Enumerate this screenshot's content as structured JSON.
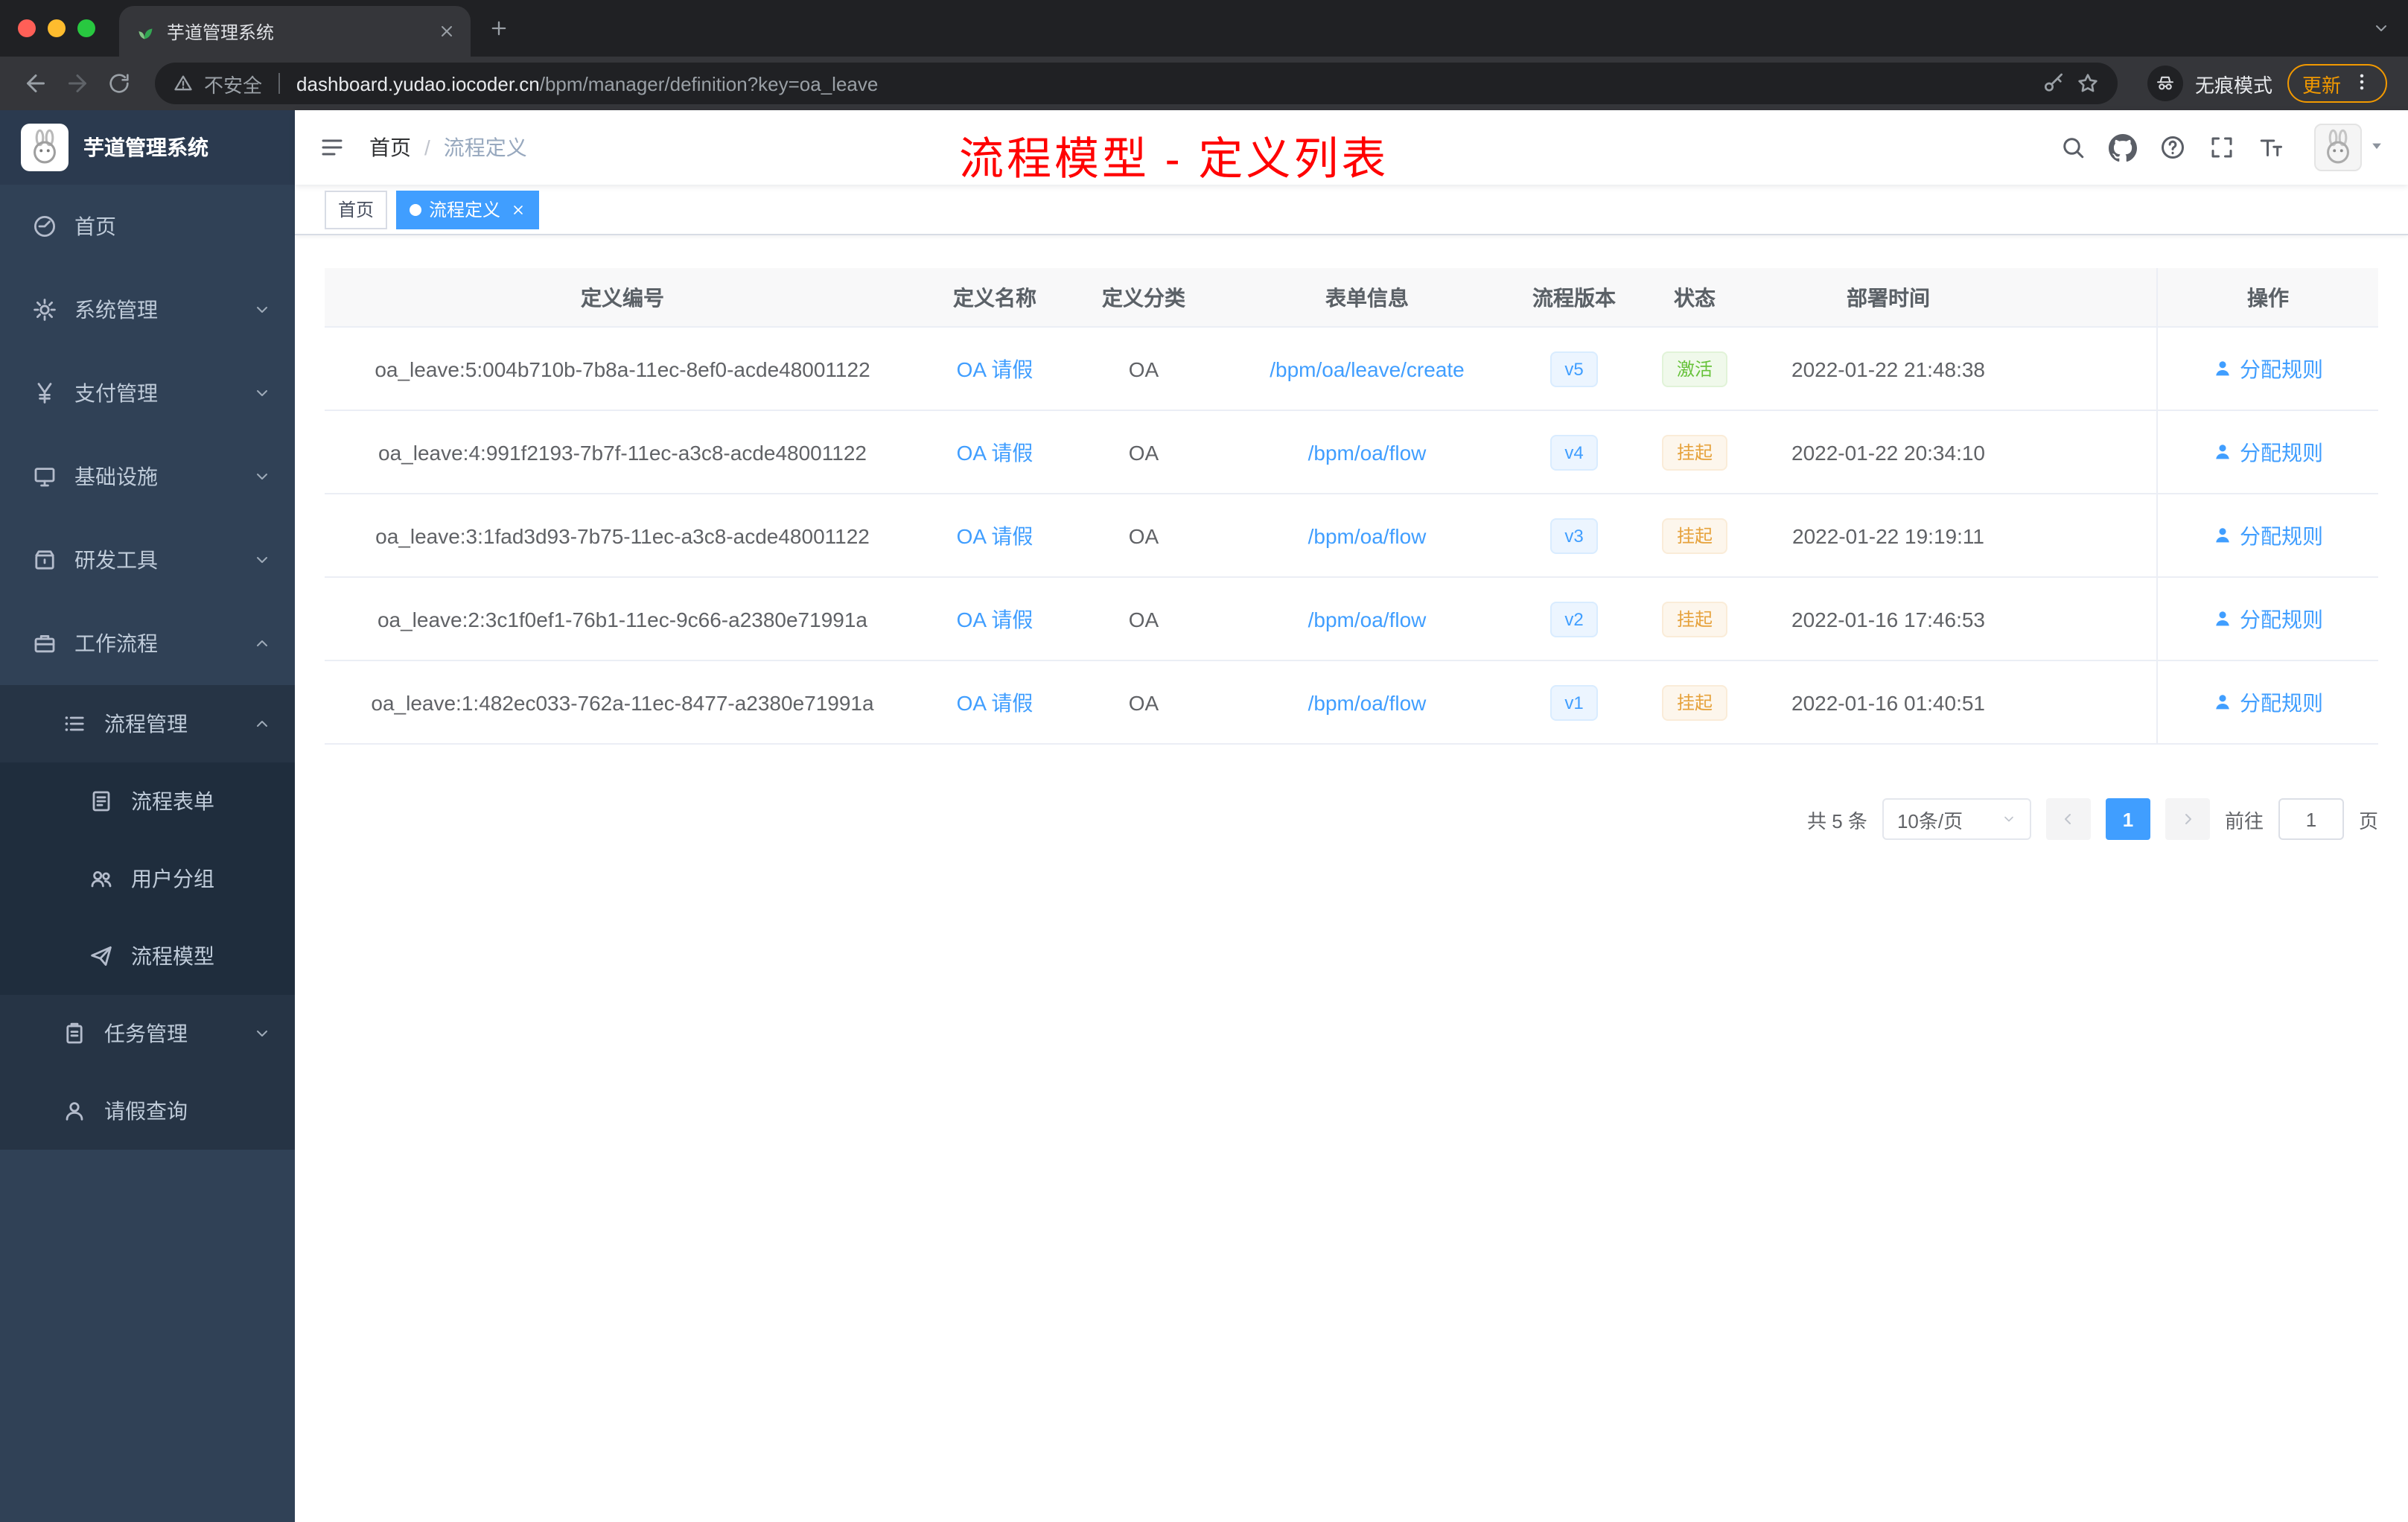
{
  "colors": {
    "primary": "#409eff",
    "success": "#67c23a",
    "warning": "#e6a23c",
    "annotation_red": "#ff0000",
    "sidebar_bg": "#304156"
  },
  "browser": {
    "tab_title": "芋道管理系统",
    "security_label": "不安全",
    "url_host": "dashboard.yudao.iocoder.cn",
    "url_path": "/bpm/manager/definition?key=oa_leave",
    "incognito_label": "无痕模式",
    "update_label": "更新",
    "icons": [
      "back-icon",
      "forward-icon",
      "reload-icon",
      "warning-icon",
      "key-icon",
      "star-icon",
      "incognito-icon",
      "more-vertical-icon",
      "new-tab-icon",
      "close-tab-icon",
      "leaf-favicon"
    ]
  },
  "sidebar": {
    "logo_title": "芋道管理系统",
    "items": [
      {
        "label": "首页",
        "icon": "dashboard-icon"
      },
      {
        "label": "系统管理",
        "icon": "gear-icon",
        "expandable": true
      },
      {
        "label": "支付管理",
        "icon": "yen-icon",
        "expandable": true
      },
      {
        "label": "基础设施",
        "icon": "monitor-icon",
        "expandable": true
      },
      {
        "label": "研发工具",
        "icon": "toolbox-icon",
        "expandable": true
      },
      {
        "label": "工作流程",
        "icon": "briefcase-icon",
        "expandable": true,
        "expanded": true
      },
      {
        "label": "流程管理",
        "icon": "list-icon",
        "expandable": true,
        "expanded": true
      },
      {
        "label": "流程表单",
        "icon": "form-icon"
      },
      {
        "label": "用户分组",
        "icon": "user-group-icon"
      },
      {
        "label": "流程模型",
        "icon": "paper-plane-icon"
      },
      {
        "label": "任务管理",
        "icon": "clipboard-icon",
        "expandable": true
      },
      {
        "label": "请假查询",
        "icon": "person-icon"
      }
    ]
  },
  "navbar": {
    "breadcrumb": [
      "首页",
      "流程定义"
    ],
    "separator": "/",
    "annotation": "流程模型 - 定义列表",
    "icons": [
      "search-icon",
      "github-icon",
      "help-icon",
      "fullscreen-icon",
      "font-size-icon",
      "avatar",
      "caret-down-icon"
    ]
  },
  "tags": {
    "home": "首页",
    "active": "流程定义"
  },
  "table": {
    "headers": [
      "定义编号",
      "定义名称",
      "定义分类",
      "表单信息",
      "流程版本",
      "状态",
      "部署时间",
      "操作"
    ],
    "rows": [
      {
        "id": "oa_leave:5:004b710b-7b8a-11ec-8ef0-acde48001122",
        "name": "OA 请假",
        "category": "OA",
        "form": "/bpm/oa/leave/create",
        "version": "v5",
        "status": "激活",
        "deploy_time": "2022-01-22 21:48:38",
        "action": "分配规则"
      },
      {
        "id": "oa_leave:4:991f2193-7b7f-11ec-a3c8-acde48001122",
        "name": "OA 请假",
        "category": "OA",
        "form": "/bpm/oa/flow",
        "version": "v4",
        "status": "挂起",
        "deploy_time": "2022-01-22 20:34:10",
        "action": "分配规则"
      },
      {
        "id": "oa_leave:3:1fad3d93-7b75-11ec-a3c8-acde48001122",
        "name": "OA 请假",
        "category": "OA",
        "form": "/bpm/oa/flow",
        "version": "v3",
        "status": "挂起",
        "deploy_time": "2022-01-22 19:19:11",
        "action": "分配规则"
      },
      {
        "id": "oa_leave:2:3c1f0ef1-76b1-11ec-9c66-a2380e71991a",
        "name": "OA 请假",
        "category": "OA",
        "form": "/bpm/oa/flow",
        "version": "v2",
        "status": "挂起",
        "deploy_time": "2022-01-16 17:46:53",
        "action": "分配规则"
      },
      {
        "id": "oa_leave:1:482ec033-762a-11ec-8477-a2380e71991a",
        "name": "OA 请假",
        "category": "OA",
        "form": "/bpm/oa/flow",
        "version": "v1",
        "status": "挂起",
        "deploy_time": "2022-01-16 01:40:51",
        "action": "分配规则"
      }
    ]
  },
  "pagination": {
    "total": "共 5 条",
    "page_size": "10条/页",
    "page": "1",
    "goto_label": "前往",
    "goto_value": "1",
    "unit": "页"
  }
}
